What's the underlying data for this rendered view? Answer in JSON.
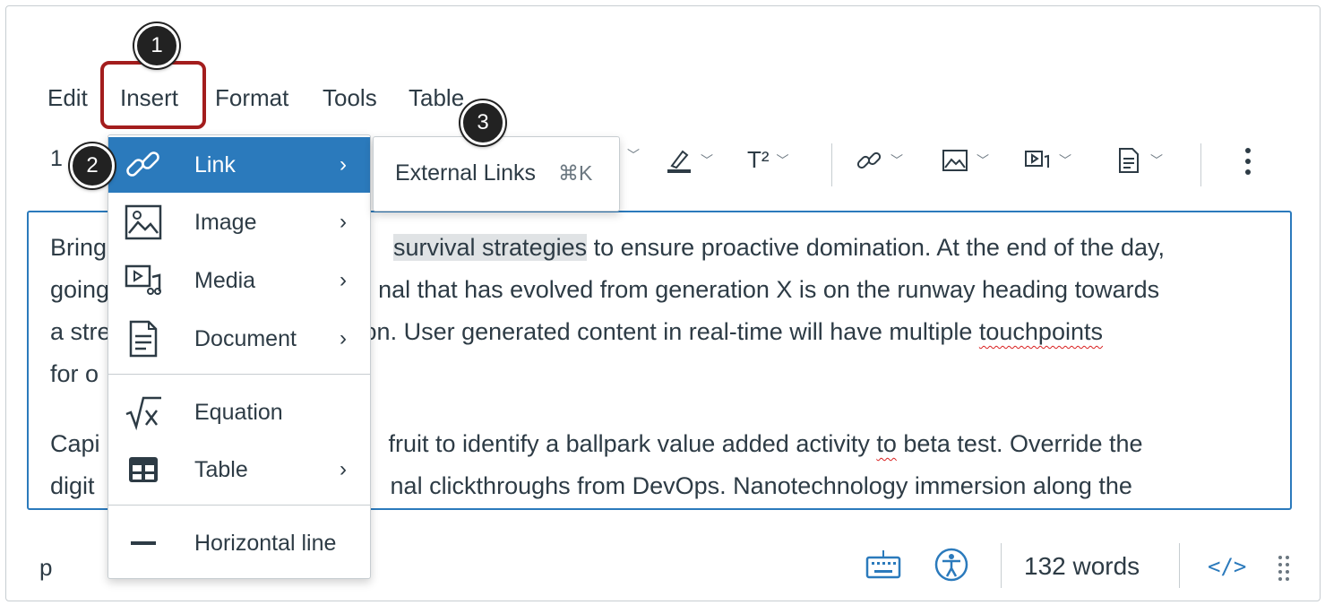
{
  "menubar": {
    "items": [
      "Edit",
      "Insert",
      "Format",
      "Tools",
      "Table"
    ]
  },
  "callouts": [
    "1",
    "2",
    "3"
  ],
  "toolbar": {
    "font_size_partial": "1",
    "superscript_label": "T²"
  },
  "insert_menu": {
    "items": [
      {
        "label": "Link",
        "icon": "link-icon",
        "has_submenu": true,
        "active": true
      },
      {
        "label": "Image",
        "icon": "image-icon",
        "has_submenu": true
      },
      {
        "label": "Media",
        "icon": "media-icon",
        "has_submenu": true
      },
      {
        "label": "Document",
        "icon": "document-icon",
        "has_submenu": true
      },
      {
        "label": "Equation",
        "icon": "equation-icon",
        "has_submenu": false
      },
      {
        "label": "Table",
        "icon": "table-icon",
        "has_submenu": true
      },
      {
        "label": "Horizontal line",
        "icon": "horizontal-line-icon",
        "has_submenu": false
      }
    ]
  },
  "link_submenu": {
    "label": "External Links",
    "shortcut": "⌘K"
  },
  "editor": {
    "para1": {
      "l1_a": "Bring",
      "l1_b": "survival strategies",
      "l1_c": " to ensure proactive domination. At the end of the day,",
      "l2_a": "going",
      "l2_b": "nal that has evolved from generation X is on the runway heading towards",
      "l3_a": "a stre",
      "l3_b": "on. User generated content in real-time will have multiple ",
      "l3_c": "touchpoints",
      "l4_a": "for o"
    },
    "para2": {
      "l1_a": "Capi",
      "l1_b": "fruit to identify a ballpark value added activity ",
      "l1_c": "to",
      "l1_d": " beta test. Override the",
      "l2_a": "digit",
      "l2_b": "nal clickthroughs from DevOps. Nanotechnology immersion along the"
    }
  },
  "statusbar": {
    "element_path": "p",
    "word_count": "132 words",
    "html_toggle": "</>"
  },
  "colors": {
    "accent": "#2b7abc",
    "callout_highlight": "#a31d1d",
    "text": "#2d3b45"
  }
}
